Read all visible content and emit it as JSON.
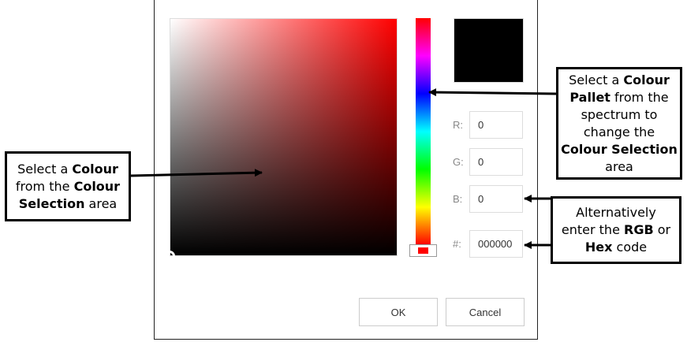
{
  "preview": {
    "color": "#000000"
  },
  "fields": {
    "r": {
      "label": "R:",
      "value": "0"
    },
    "g": {
      "label": "G:",
      "value": "0"
    },
    "b": {
      "label": "B:",
      "value": "0"
    },
    "hex": {
      "label": "#:",
      "value": "000000"
    }
  },
  "buttons": {
    "ok": "OK",
    "cancel": "Cancel"
  },
  "callouts": {
    "left": {
      "l1a": "Select a ",
      "l1b": "Colour",
      "l2a": "from the ",
      "l2b": "Colour",
      "l3a": "Selection",
      "l3b": " area"
    },
    "right_top": {
      "l1a": "Select a ",
      "l1b": "Colour",
      "l2a": "Pallet",
      "l2b": " from the",
      "l3": "spectrum to",
      "l4": "change the",
      "l5": "Colour Selection",
      "l6": "area"
    },
    "right_bottom": {
      "l1": "Alternatively",
      "l2a": "enter the ",
      "l2b": "RGB",
      "l2c": " or",
      "l3a": "Hex",
      "l3b": " code"
    }
  }
}
